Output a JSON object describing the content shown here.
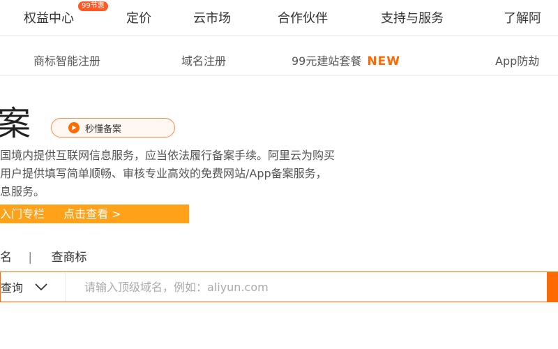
{
  "topnav": {
    "items": [
      "权益中心",
      "定价",
      "云市场",
      "合作伙伴",
      "支持与服务",
      "了解阿"
    ],
    "badge": "99节惠"
  },
  "subnav": {
    "items": [
      "商标智能注册",
      "域名注册",
      "99元建站套餐",
      "App防劫"
    ],
    "new_tag": "NEW"
  },
  "hero": {
    "title": "案",
    "quick_button": "秒懂备案",
    "desc_lines": [
      "国境内提供互联网信息服务，应当依法履行备案手续。阿里云为购买",
      "用户提供填写简单顺畅、审核专业高效的免费网站/App备案服务，",
      "息服务。"
    ],
    "banner": {
      "left": "入门专栏",
      "right": "点击查看 >"
    }
  },
  "search": {
    "tabs": [
      "名",
      "查商标"
    ],
    "separator": "|",
    "select_value": "查询",
    "placeholder": "请输入顶级域名，例如：aliyun.com"
  },
  "colors": {
    "accent": "#ff6a00",
    "banner": "#ffa21a"
  }
}
